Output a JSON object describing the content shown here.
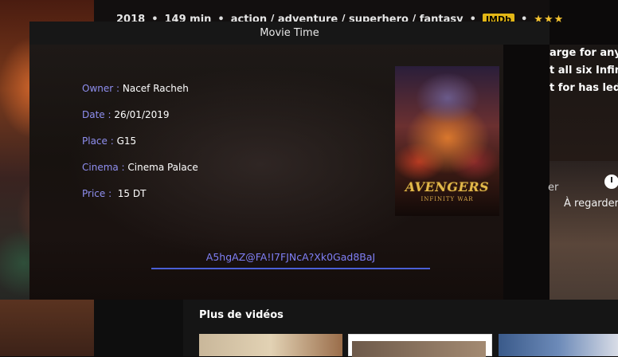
{
  "background": {
    "meta": {
      "year": "2018",
      "duration": "149 min",
      "genres": "action / adventure / superhero / fantasy",
      "imdb_badge": "IMDb",
      "stars": "★★★★★"
    },
    "description_lines": [
      "arge for any o",
      "t all six Infinity",
      "t for has led u"
    ],
    "partial_heading": "er",
    "video_label": "À regarder",
    "more_videos_title": "Plus de vidéos"
  },
  "modal": {
    "title": "Movie Time",
    "fields": [
      {
        "label": "Owner : ",
        "value": "Nacef Racheh"
      },
      {
        "label": "Date : ",
        "value": "26/01/2019"
      },
      {
        "label": "Place : ",
        "value": "G15"
      },
      {
        "label": "Cinema : ",
        "value": "Cinema Palace"
      },
      {
        "label": "Price : ",
        "value": " 15 DT"
      }
    ],
    "poster": {
      "title": "AVENGERS",
      "subtitle": "INFINITY WAR"
    },
    "code": "A5hgAZ@FA!I7FJNcA?Xk0Gad8BaJ"
  },
  "colors": {
    "label": "#8f8ff0",
    "code_text": "#7f7ff5",
    "code_underline": "#4a5fd6",
    "titlebar": "#171717"
  }
}
